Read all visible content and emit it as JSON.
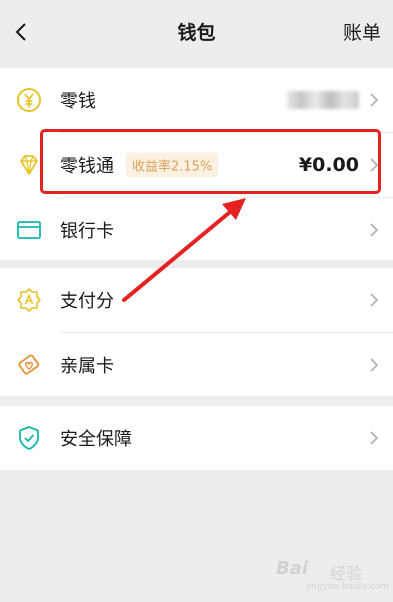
{
  "header": {
    "title": "钱包",
    "right_action": "账单"
  },
  "section1": {
    "items": [
      {
        "label": "零钱",
        "icon": "yuan-coin-icon"
      },
      {
        "label": "零钱通",
        "icon": "diamond-icon",
        "badge": "收益率2.15%",
        "amount": "¥0.00"
      },
      {
        "label": "银行卡",
        "icon": "bank-card-icon"
      }
    ]
  },
  "section2": {
    "items": [
      {
        "label": "支付分",
        "icon": "pay-score-icon"
      },
      {
        "label": "亲属卡",
        "icon": "family-card-icon"
      }
    ]
  },
  "section3": {
    "items": [
      {
        "label": "安全保障",
        "icon": "shield-icon"
      }
    ]
  },
  "watermark": {
    "brand": "Bai",
    "suffix": "经验",
    "url": "jingyan.baidu.com"
  },
  "colors": {
    "accent_gold": "#e9c32a",
    "accent_teal": "#12b8ad",
    "accent_orange": "#e8913a",
    "badge_text": "#d8a158",
    "badge_bg": "#fbf1e2",
    "highlight_red": "#e52222"
  }
}
